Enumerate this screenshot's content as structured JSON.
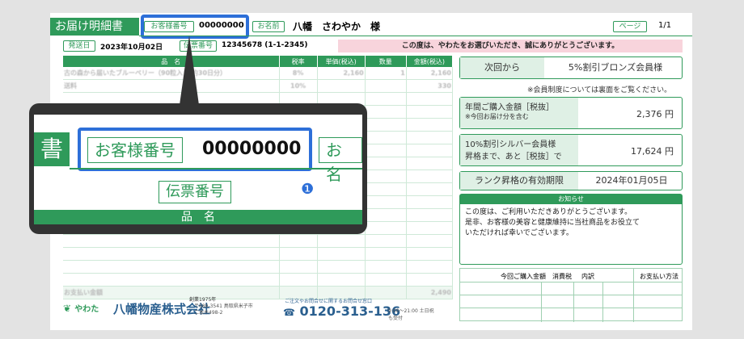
{
  "header": {
    "title": "お届け明細書",
    "customer_no_label": "お客様番号",
    "customer_no": "00000000",
    "name_label": "お名前",
    "name": "八幡　さわやか　様",
    "page_label": "ページ",
    "page": "1/1"
  },
  "meta": {
    "issue_label": "発送日",
    "issue_date": "2023年10月02日",
    "slip_label": "伝票番号",
    "slip_no": "12345678 (1-1-2345)",
    "thanks": "この度は、やわたをお選びいただき、誠にありがとうございます。"
  },
  "items_table": {
    "columns": [
      "品　名",
      "税率",
      "単価(税込)",
      "数量",
      "金額(税込)"
    ],
    "rows": [
      {
        "name": "古の森から届いたブルーベリー（90粒入り 約30日分）",
        "tax": "8%",
        "price": "2,160",
        "qty": "1",
        "amount": "2,160"
      },
      {
        "name": "送料",
        "tax": "10%",
        "price": "",
        "qty": "",
        "amount": "330"
      }
    ],
    "total_label": "お支払い金額",
    "total": "2,490"
  },
  "right": {
    "next_label": "次回から",
    "next_value": "5%割引ブロンズ会員様",
    "membership_note": "※会員制度については裏面をご覧ください。",
    "annual_label": "年間ご購入金額［税抜］",
    "annual_sub": "※今回お届け分を含む",
    "annual_value": "2,376 円",
    "silver_label": "10%割引シルバー会員様",
    "silver_label2": "昇格まで、あと［税抜］で",
    "silver_value": "17,624 円",
    "expire_label": "ランク昇格の有効期限",
    "expire_value": "2024年01月05日",
    "notice_title": "お知らせ",
    "notice_lines": [
      "この度は、ご利用いただきありがとうございます。",
      "是非、お客様の美容と健康維持に当社商品をお役立て",
      "いただければ幸いでございます。"
    ],
    "summary_cols": [
      "今回ご購入金額",
      "消費税",
      "内訳",
      "お支払い方法"
    ]
  },
  "footer": {
    "brand": "やわた",
    "company": "八幡物産株式会社",
    "founded": "創業1975年",
    "address": "〒689-3541 鳥取県米子市二本木498-2",
    "phone_note": "ご注文やお問合せに関するお問合せ窓口",
    "phone": "0120-313-136",
    "hours": "9:00〜21:00 土日祝も受付"
  },
  "callout": {
    "title_char": "書",
    "customer_no_label": "お客様番号",
    "customer_no": "00000000",
    "name_label_partial": "お名",
    "slip_label": "伝票番号",
    "badge": "❶",
    "bar_text": "品　名"
  }
}
